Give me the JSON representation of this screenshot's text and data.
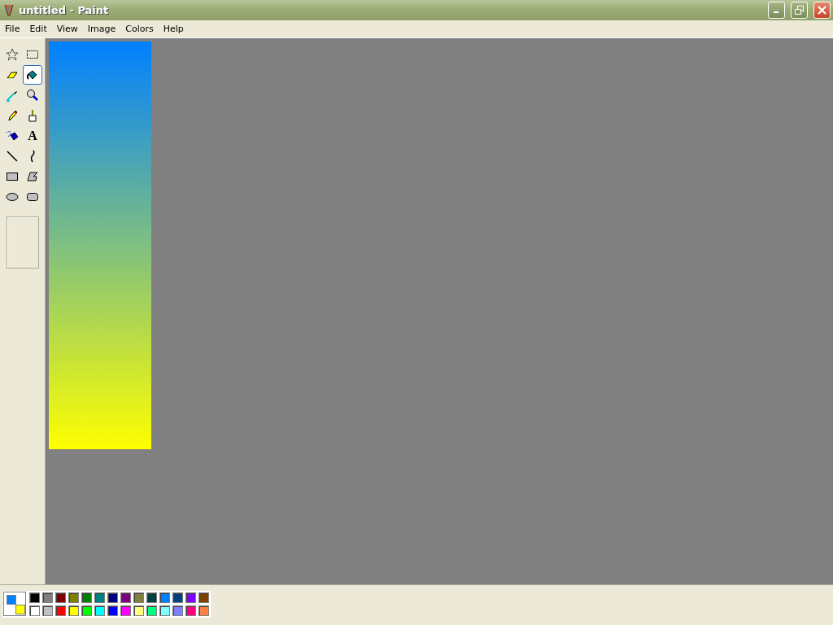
{
  "window": {
    "title": "untitled - Paint"
  },
  "menu": [
    "File",
    "Edit",
    "View",
    "Image",
    "Colors",
    "Help"
  ],
  "tools": [
    {
      "kind": "free-select",
      "selected": false
    },
    {
      "kind": "select",
      "selected": false
    },
    {
      "kind": "eraser",
      "selected": false
    },
    {
      "kind": "fill",
      "selected": true
    },
    {
      "kind": "picker",
      "selected": false
    },
    {
      "kind": "magnifier",
      "selected": false
    },
    {
      "kind": "pencil",
      "selected": false
    },
    {
      "kind": "brush",
      "selected": false
    },
    {
      "kind": "airbrush",
      "selected": false
    },
    {
      "kind": "text",
      "selected": false,
      "label": "A"
    },
    {
      "kind": "line",
      "selected": false
    },
    {
      "kind": "curve",
      "selected": false
    },
    {
      "kind": "rectangle",
      "selected": false
    },
    {
      "kind": "polygon",
      "selected": false
    },
    {
      "kind": "ellipse",
      "selected": false
    },
    {
      "kind": "rounded-rectangle",
      "selected": false
    }
  ],
  "current_colors": [
    {
      "kind": "foreground",
      "color": "#0080ff"
    },
    {
      "kind": "background",
      "color": "#ffff00"
    }
  ],
  "palette": [
    {
      "color": "#000000"
    },
    {
      "color": "#808080"
    },
    {
      "color": "#800000"
    },
    {
      "color": "#808000"
    },
    {
      "color": "#008000"
    },
    {
      "color": "#008080"
    },
    {
      "color": "#000080"
    },
    {
      "color": "#800080"
    },
    {
      "color": "#808040"
    },
    {
      "color": "#004040"
    },
    {
      "color": "#0080ff"
    },
    {
      "color": "#004080"
    },
    {
      "color": "#8000ff"
    },
    {
      "color": "#804000"
    },
    {
      "color": "#ffffff"
    },
    {
      "color": "#c0c0c0"
    },
    {
      "color": "#ff0000"
    },
    {
      "color": "#ffff00"
    },
    {
      "color": "#00ff00"
    },
    {
      "color": "#00ffff"
    },
    {
      "color": "#0000ff"
    },
    {
      "color": "#ff00ff"
    },
    {
      "color": "#ffff80"
    },
    {
      "color": "#00ff80"
    },
    {
      "color": "#80ffff"
    },
    {
      "color": "#8080ff"
    },
    {
      "color": "#ff0080"
    },
    {
      "color": "#ff8040"
    }
  ]
}
